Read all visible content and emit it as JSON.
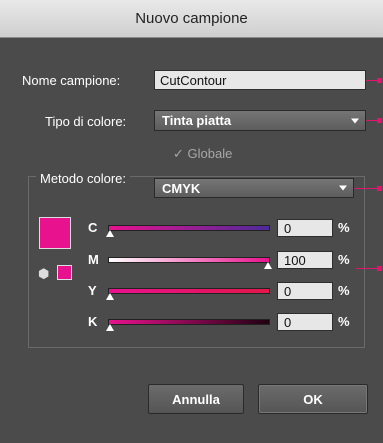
{
  "window": {
    "title": "Nuovo campione"
  },
  "form": {
    "name_label": "Nome campione:",
    "name_value": "CutContour",
    "type_label": "Tipo di colore:",
    "type_value": "Tinta piatta",
    "global_check": "✓",
    "global_label": "Globale",
    "mode_label": "Metodo colore:",
    "mode_value": "CMYK"
  },
  "colors": {
    "accent": "#e0136f",
    "swatch": "#e8128e"
  },
  "channels": [
    {
      "letter": "C",
      "value": "0",
      "unit": "%",
      "level": 0
    },
    {
      "letter": "M",
      "value": "100",
      "unit": "%",
      "level": 100
    },
    {
      "letter": "Y",
      "value": "0",
      "unit": "%",
      "level": 0
    },
    {
      "letter": "K",
      "value": "0",
      "unit": "%",
      "level": 0
    }
  ],
  "icons": {
    "gamut": "cube-icon"
  },
  "buttons": {
    "cancel": "Annulla",
    "ok": "OK"
  }
}
